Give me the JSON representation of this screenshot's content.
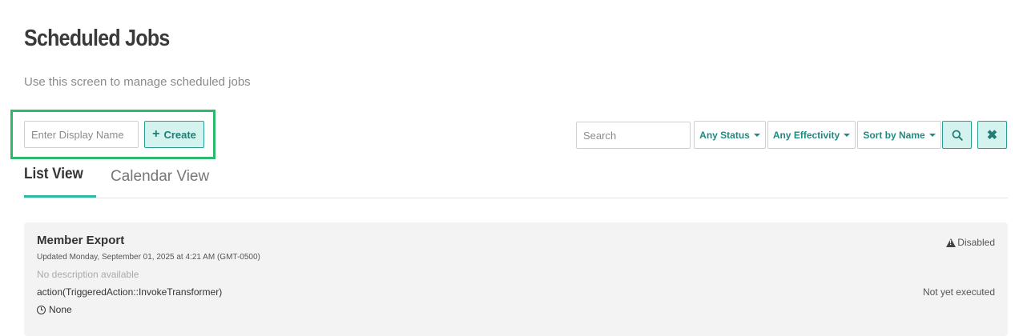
{
  "page": {
    "title": "Scheduled Jobs",
    "subtitle": "Use this screen to manage scheduled jobs"
  },
  "create_form": {
    "name_placeholder": "Enter Display Name",
    "create_label": "Create",
    "create_icon": "plus-icon"
  },
  "filters": {
    "search_placeholder": "Search",
    "status_label": "Any Status",
    "effectivity_label": "Any Effectivity",
    "sort_label": "Sort by Name",
    "search_button_icon": "search-icon",
    "clear_button_icon": "close-icon",
    "clear_glyph": "✖"
  },
  "tabs": [
    {
      "label": "List View",
      "active": true
    },
    {
      "label": "Calendar View",
      "active": false
    }
  ],
  "jobs": [
    {
      "name": "Member Export",
      "updated": "Updated Monday, September 01, 2025 at 4:21 AM (GMT-0500)",
      "description": "No description available",
      "action": "action(TriggeredAction::InvokeTransformer)",
      "schedule": "None",
      "status": "Disabled",
      "status_icon": "warning-icon",
      "execution": "Not yet executed"
    }
  ],
  "colors": {
    "accent": "#2eb8a6",
    "highlight": "#2eb86b",
    "button_bg": "#d4f2ee",
    "button_text": "#1f7f75",
    "card_bg": "#f3f3f3"
  }
}
